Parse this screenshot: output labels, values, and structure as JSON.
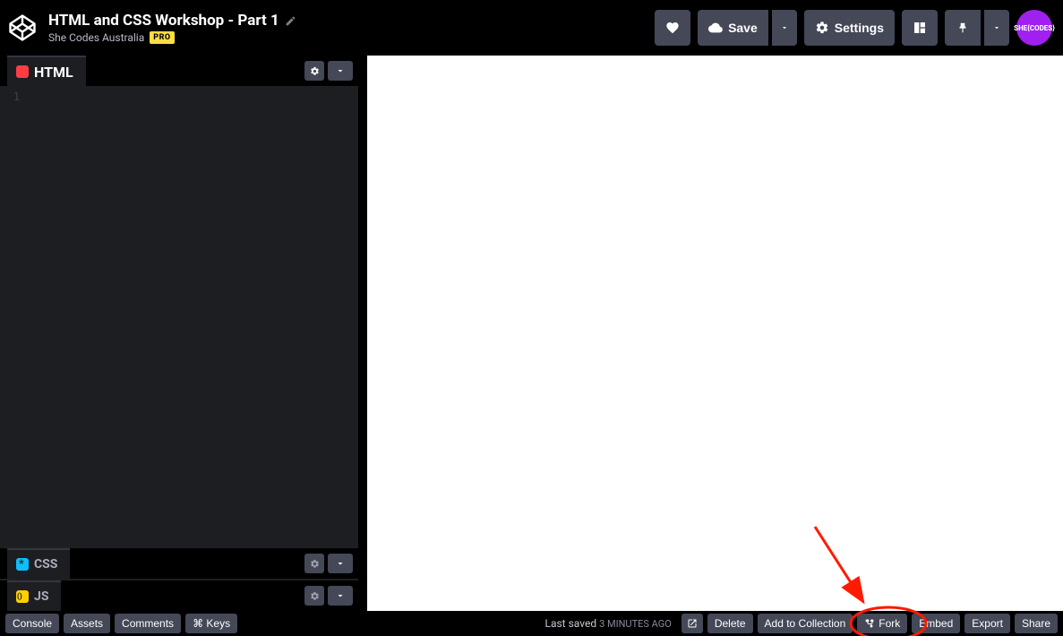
{
  "header": {
    "title": "HTML and CSS Workshop - Part 1",
    "author": "She Codes Australia",
    "pro_badge": "PRO",
    "save": "Save",
    "settings": "Settings",
    "avatar_text": "SHE{CODES}"
  },
  "panels": {
    "html": {
      "label": "HTML",
      "line": "1"
    },
    "css": {
      "label": "CSS"
    },
    "js": {
      "label": "JS"
    }
  },
  "footer": {
    "console": "Console",
    "assets": "Assets",
    "comments": "Comments",
    "keys": "⌘ Keys",
    "saved_prefix": "Last saved",
    "saved_time": "3 MINUTES AGO",
    "delete": "Delete",
    "add_collection": "Add to Collection",
    "fork": "Fork",
    "embed": "Embed",
    "export": "Export",
    "share": "Share"
  }
}
